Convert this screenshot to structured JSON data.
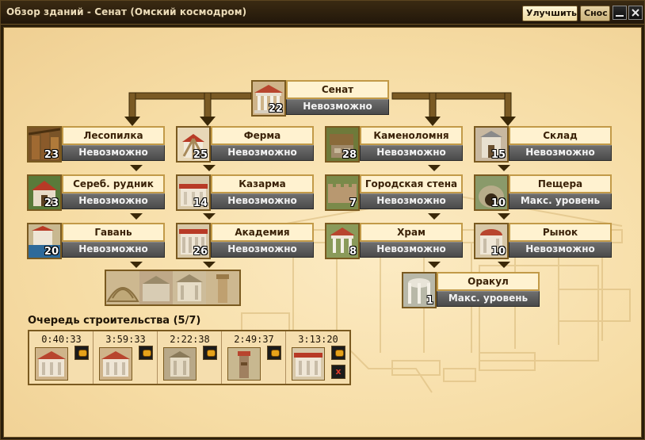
{
  "window": {
    "title": "Обзор зданий - Сенат (Омский космодром)",
    "tabs": [
      {
        "label": "Улучшить",
        "active": true
      },
      {
        "label": "Снос",
        "active": false
      }
    ],
    "controls": {
      "minimize": "minimize-icon",
      "close": "close-icon"
    }
  },
  "buildings": {
    "senate": {
      "name": "Сенат",
      "level": "22",
      "status": "Невозможно"
    },
    "lumber": {
      "name": "Лесопилка",
      "level": "23",
      "status": "Невозможно"
    },
    "farm": {
      "name": "Ферма",
      "level": "25",
      "status": "Невозможно"
    },
    "quarry": {
      "name": "Каменоломня",
      "level": "28",
      "status": "Невозможно"
    },
    "warehouse": {
      "name": "Склад",
      "level": "15",
      "status": "Невозможно"
    },
    "silver_mine": {
      "name": "Сереб. рудник",
      "level": "23",
      "status": "Невозможно"
    },
    "barracks": {
      "name": "Казарма",
      "level": "14",
      "status": "Невозможно"
    },
    "city_wall": {
      "name": "Городская стена",
      "level": "7",
      "status": "Невозможно"
    },
    "cave": {
      "name": "Пещера",
      "level": "10",
      "status": "Макс. уровень"
    },
    "harbor": {
      "name": "Гавань",
      "level": "20",
      "status": "Невозможно"
    },
    "academy": {
      "name": "Академия",
      "level": "26",
      "status": "Невозможно"
    },
    "temple": {
      "name": "Храм",
      "level": "8",
      "status": "Невозможно"
    },
    "market": {
      "name": "Рынок",
      "level": "10",
      "status": "Невозможно"
    },
    "oracle": {
      "name": "Оракул",
      "level": "1",
      "status": "Макс. уровень"
    }
  },
  "special_buildings": [
    "theater-icon",
    "thermal-bath-icon",
    "library-icon",
    "lighthouse-icon"
  ],
  "queue": {
    "title": "Очередь строительства (5/7)",
    "items": [
      {
        "time": "0:40:33",
        "icon": "senate-icon"
      },
      {
        "time": "3:59:33",
        "icon": "senate-icon"
      },
      {
        "time": "2:22:38",
        "icon": "temple-icon"
      },
      {
        "time": "2:49:37",
        "icon": "tower-icon"
      },
      {
        "time": "3:13:20",
        "icon": "academy-icon",
        "cancel": "x"
      }
    ]
  },
  "colors": {
    "panel_bg": "#f6dca4",
    "name_bg": "#fff2d0",
    "status_bg": "#5a5a5a",
    "frame": "#7a5a20",
    "title_bg": "#2a1d0a"
  }
}
